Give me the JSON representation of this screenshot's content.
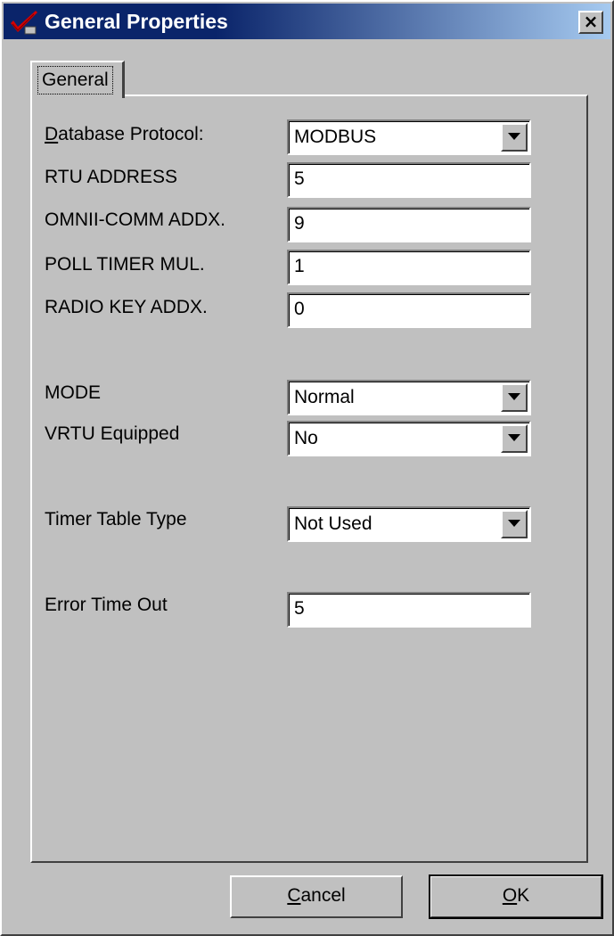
{
  "window": {
    "title": "General Properties",
    "close_glyph": "×",
    "icon": "red-checkmark-icon"
  },
  "tabs": [
    {
      "label": "General",
      "selected": true
    }
  ],
  "fields": {
    "database_protocol": {
      "label_accel": "D",
      "label_rest": "atabase Protocol:",
      "value": "MODBUS"
    },
    "rtu_address": {
      "label": "RTU ADDRESS",
      "value": "5"
    },
    "omnii_comm_addx": {
      "label": "OMNII-COMM ADDX.",
      "value": "9"
    },
    "poll_timer_mul": {
      "label": "POLL TIMER MUL.",
      "value": "1"
    },
    "radio_key_addx": {
      "label": "RADIO KEY ADDX.",
      "value": "0"
    },
    "mode": {
      "label": "MODE",
      "value": "Normal"
    },
    "vrtu_equipped": {
      "label": "VRTU Equipped",
      "value": "No"
    },
    "timer_table_type": {
      "label": "Timer Table Type",
      "value": "Not Used"
    },
    "error_time_out": {
      "label": "Error Time Out",
      "value": "5"
    }
  },
  "buttons": {
    "cancel": {
      "accel": "C",
      "rest": "ancel"
    },
    "ok": {
      "accel": "O",
      "rest": "K"
    }
  },
  "colors": {
    "titlebar_start": "#0a246a",
    "titlebar_end": "#a6caf0",
    "face": "#c0c0c0",
    "icon_red": "#d40000"
  }
}
